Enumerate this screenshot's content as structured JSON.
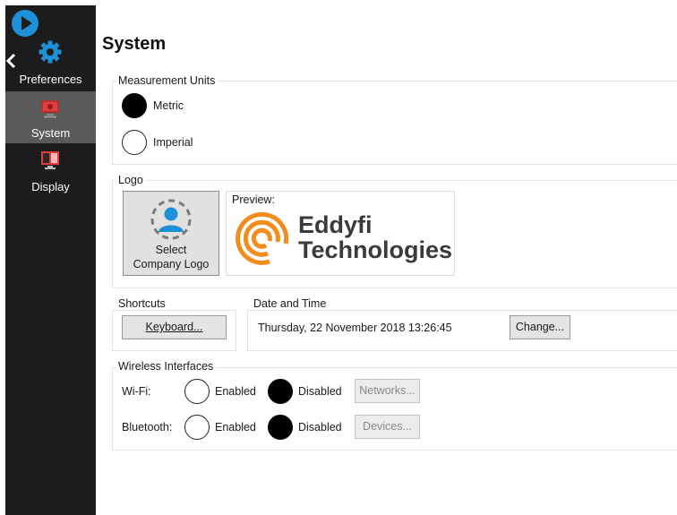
{
  "sidebar": {
    "items": [
      {
        "label": "Preferences",
        "icon": "gear-icon",
        "icon_color": "#1e90d6"
      },
      {
        "label": "System",
        "icon": "system-monitor-icon",
        "icon_color": "#e23b3b",
        "selected": true
      },
      {
        "label": "Display",
        "icon": "display-icon",
        "icon_color": "#e23b3b"
      }
    ]
  },
  "page": {
    "title": "System"
  },
  "measurement_units": {
    "label": "Measurement Units",
    "options": [
      {
        "label": "Metric",
        "selected": true
      },
      {
        "label": "Imperial",
        "selected": false
      }
    ]
  },
  "logo": {
    "label": "Logo",
    "select_button": {
      "line1": "Select",
      "line2": "Company Logo"
    },
    "preview_label": "Preview:",
    "brand_line1": "Eddyfi",
    "brand_line2": "Technologies",
    "brand_color": "#f28c1b"
  },
  "shortcuts": {
    "label": "Shortcuts",
    "keyboard_button": "Keyboard..."
  },
  "date_time": {
    "label": "Date and Time",
    "value": "Thursday, 22 November 2018 13:26:45",
    "change_button": "Change..."
  },
  "wireless": {
    "label": "Wireless Interfaces",
    "rows": [
      {
        "name": "Wi-Fi:",
        "enabled_label": "Enabled",
        "disabled_label": "Disabled",
        "state": "Disabled",
        "button": "Networks..."
      },
      {
        "name": "Bluetooth:",
        "enabled_label": "Enabled",
        "disabled_label": "Disabled",
        "state": "Disabled",
        "button": "Devices..."
      }
    ]
  }
}
